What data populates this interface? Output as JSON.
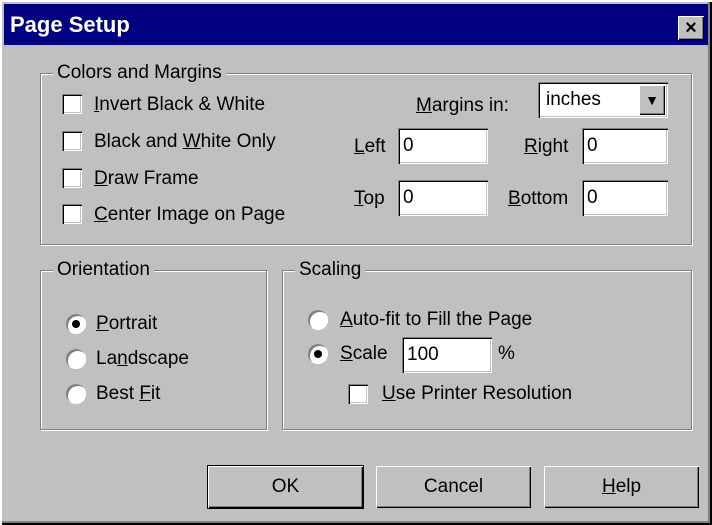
{
  "window": {
    "title": "Page Setup",
    "close_glyph": "×"
  },
  "colors_margins": {
    "legend": "Colors and Margins",
    "invert": {
      "pre": "",
      "key": "I",
      "post": "nvert Black & White",
      "checked": false
    },
    "bw_only": {
      "pre": "Black and ",
      "key": "W",
      "post": "hite Only",
      "checked": false
    },
    "draw_frame": {
      "pre": "",
      "key": "D",
      "post": "raw Frame",
      "checked": false
    },
    "center_image": {
      "pre": "",
      "key": "C",
      "post": "enter Image on Page",
      "checked": false
    },
    "margins_in": {
      "pre": "",
      "key": "M",
      "post": "argins in:",
      "value": "inches"
    },
    "left": {
      "key": "L",
      "post": "eft",
      "value": "0"
    },
    "right": {
      "key": "R",
      "post": "ight",
      "value": "0"
    },
    "top": {
      "key": "T",
      "post": "op",
      "value": "0"
    },
    "bottom": {
      "key": "B",
      "post": "ottom",
      "value": "0"
    }
  },
  "orientation": {
    "legend": "Orientation",
    "portrait": {
      "pre": "",
      "key": "P",
      "post": "ortrait",
      "selected": true
    },
    "landscape": {
      "pre": "La",
      "key": "n",
      "post": "dscape",
      "selected": false
    },
    "best_fit": {
      "pre": "Best ",
      "key": "F",
      "post": "it",
      "selected": false
    }
  },
  "scaling": {
    "legend": "Scaling",
    "autofit": {
      "pre": "",
      "key": "A",
      "post": "uto-fit to Fill the Page",
      "selected": false
    },
    "scale": {
      "pre": "",
      "key": "S",
      "post": "cale",
      "selected": true,
      "value": "100",
      "unit": "%"
    },
    "printer_res": {
      "pre": "",
      "key": "U",
      "post": "se Printer Resolution",
      "checked": false
    }
  },
  "buttons": {
    "ok": "OK",
    "cancel": "Cancel",
    "help": {
      "key": "H",
      "post": "elp"
    }
  }
}
